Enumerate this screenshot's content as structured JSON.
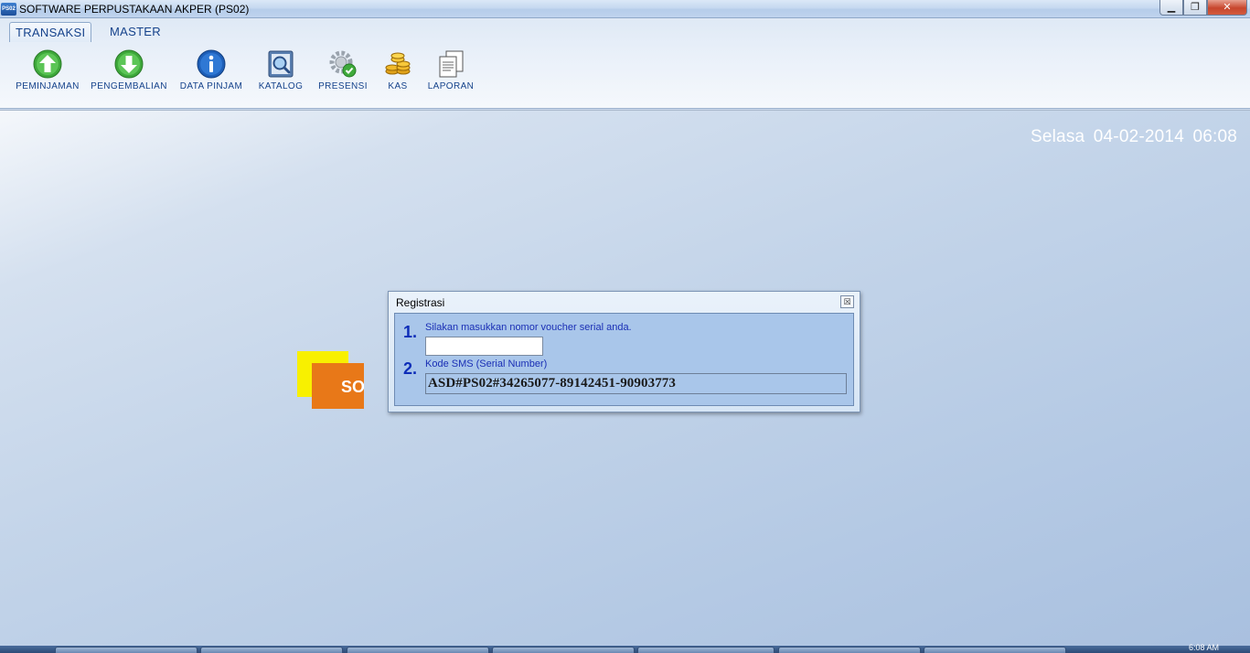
{
  "window": {
    "icon_text": "PS02",
    "title": "SOFTWARE PERPUSTAKAAN AKPER (PS02)",
    "minimize_label": "▁",
    "maximize_label": "❐",
    "close_label": "✕"
  },
  "ribbon": {
    "tabs": [
      {
        "label": "TRANSAKSI",
        "active": true
      },
      {
        "label": "MASTER",
        "active": false
      }
    ],
    "tools": [
      {
        "label": "PEMINJAMAN",
        "icon": "arrow-up-icon"
      },
      {
        "label": "PENGEMBALIAN",
        "icon": "arrow-down-icon"
      },
      {
        "label": "DATA PINJAM",
        "icon": "info-icon"
      },
      {
        "label": "KATALOG",
        "icon": "magnifier-icon"
      },
      {
        "label": "PRESENSI",
        "icon": "gear-check-icon"
      },
      {
        "label": "KAS",
        "icon": "coins-icon"
      },
      {
        "label": "LAPORAN",
        "icon": "documents-icon"
      }
    ]
  },
  "main": {
    "datetime": "Selasa  04-02-2014  06:08",
    "logo_text": "SOFT"
  },
  "dialog": {
    "title": "Registrasi",
    "close_label": "☒",
    "step1_number": "1.",
    "step1_label": "Silakan masukkan nomor voucher serial anda.",
    "voucher_value": "",
    "step2_number": "2.",
    "step2_label": "Kode SMS (Serial Number)",
    "serial_code": "ASD#PS02#34265077-89142451-90903773"
  },
  "taskbar": {
    "clock": "6:08 AM"
  },
  "colors": {
    "ribbon_text": "#15428b",
    "dialog_text": "#1a2fb5",
    "logo_yellow": "#f8f000",
    "logo_orange": "#e87818"
  }
}
